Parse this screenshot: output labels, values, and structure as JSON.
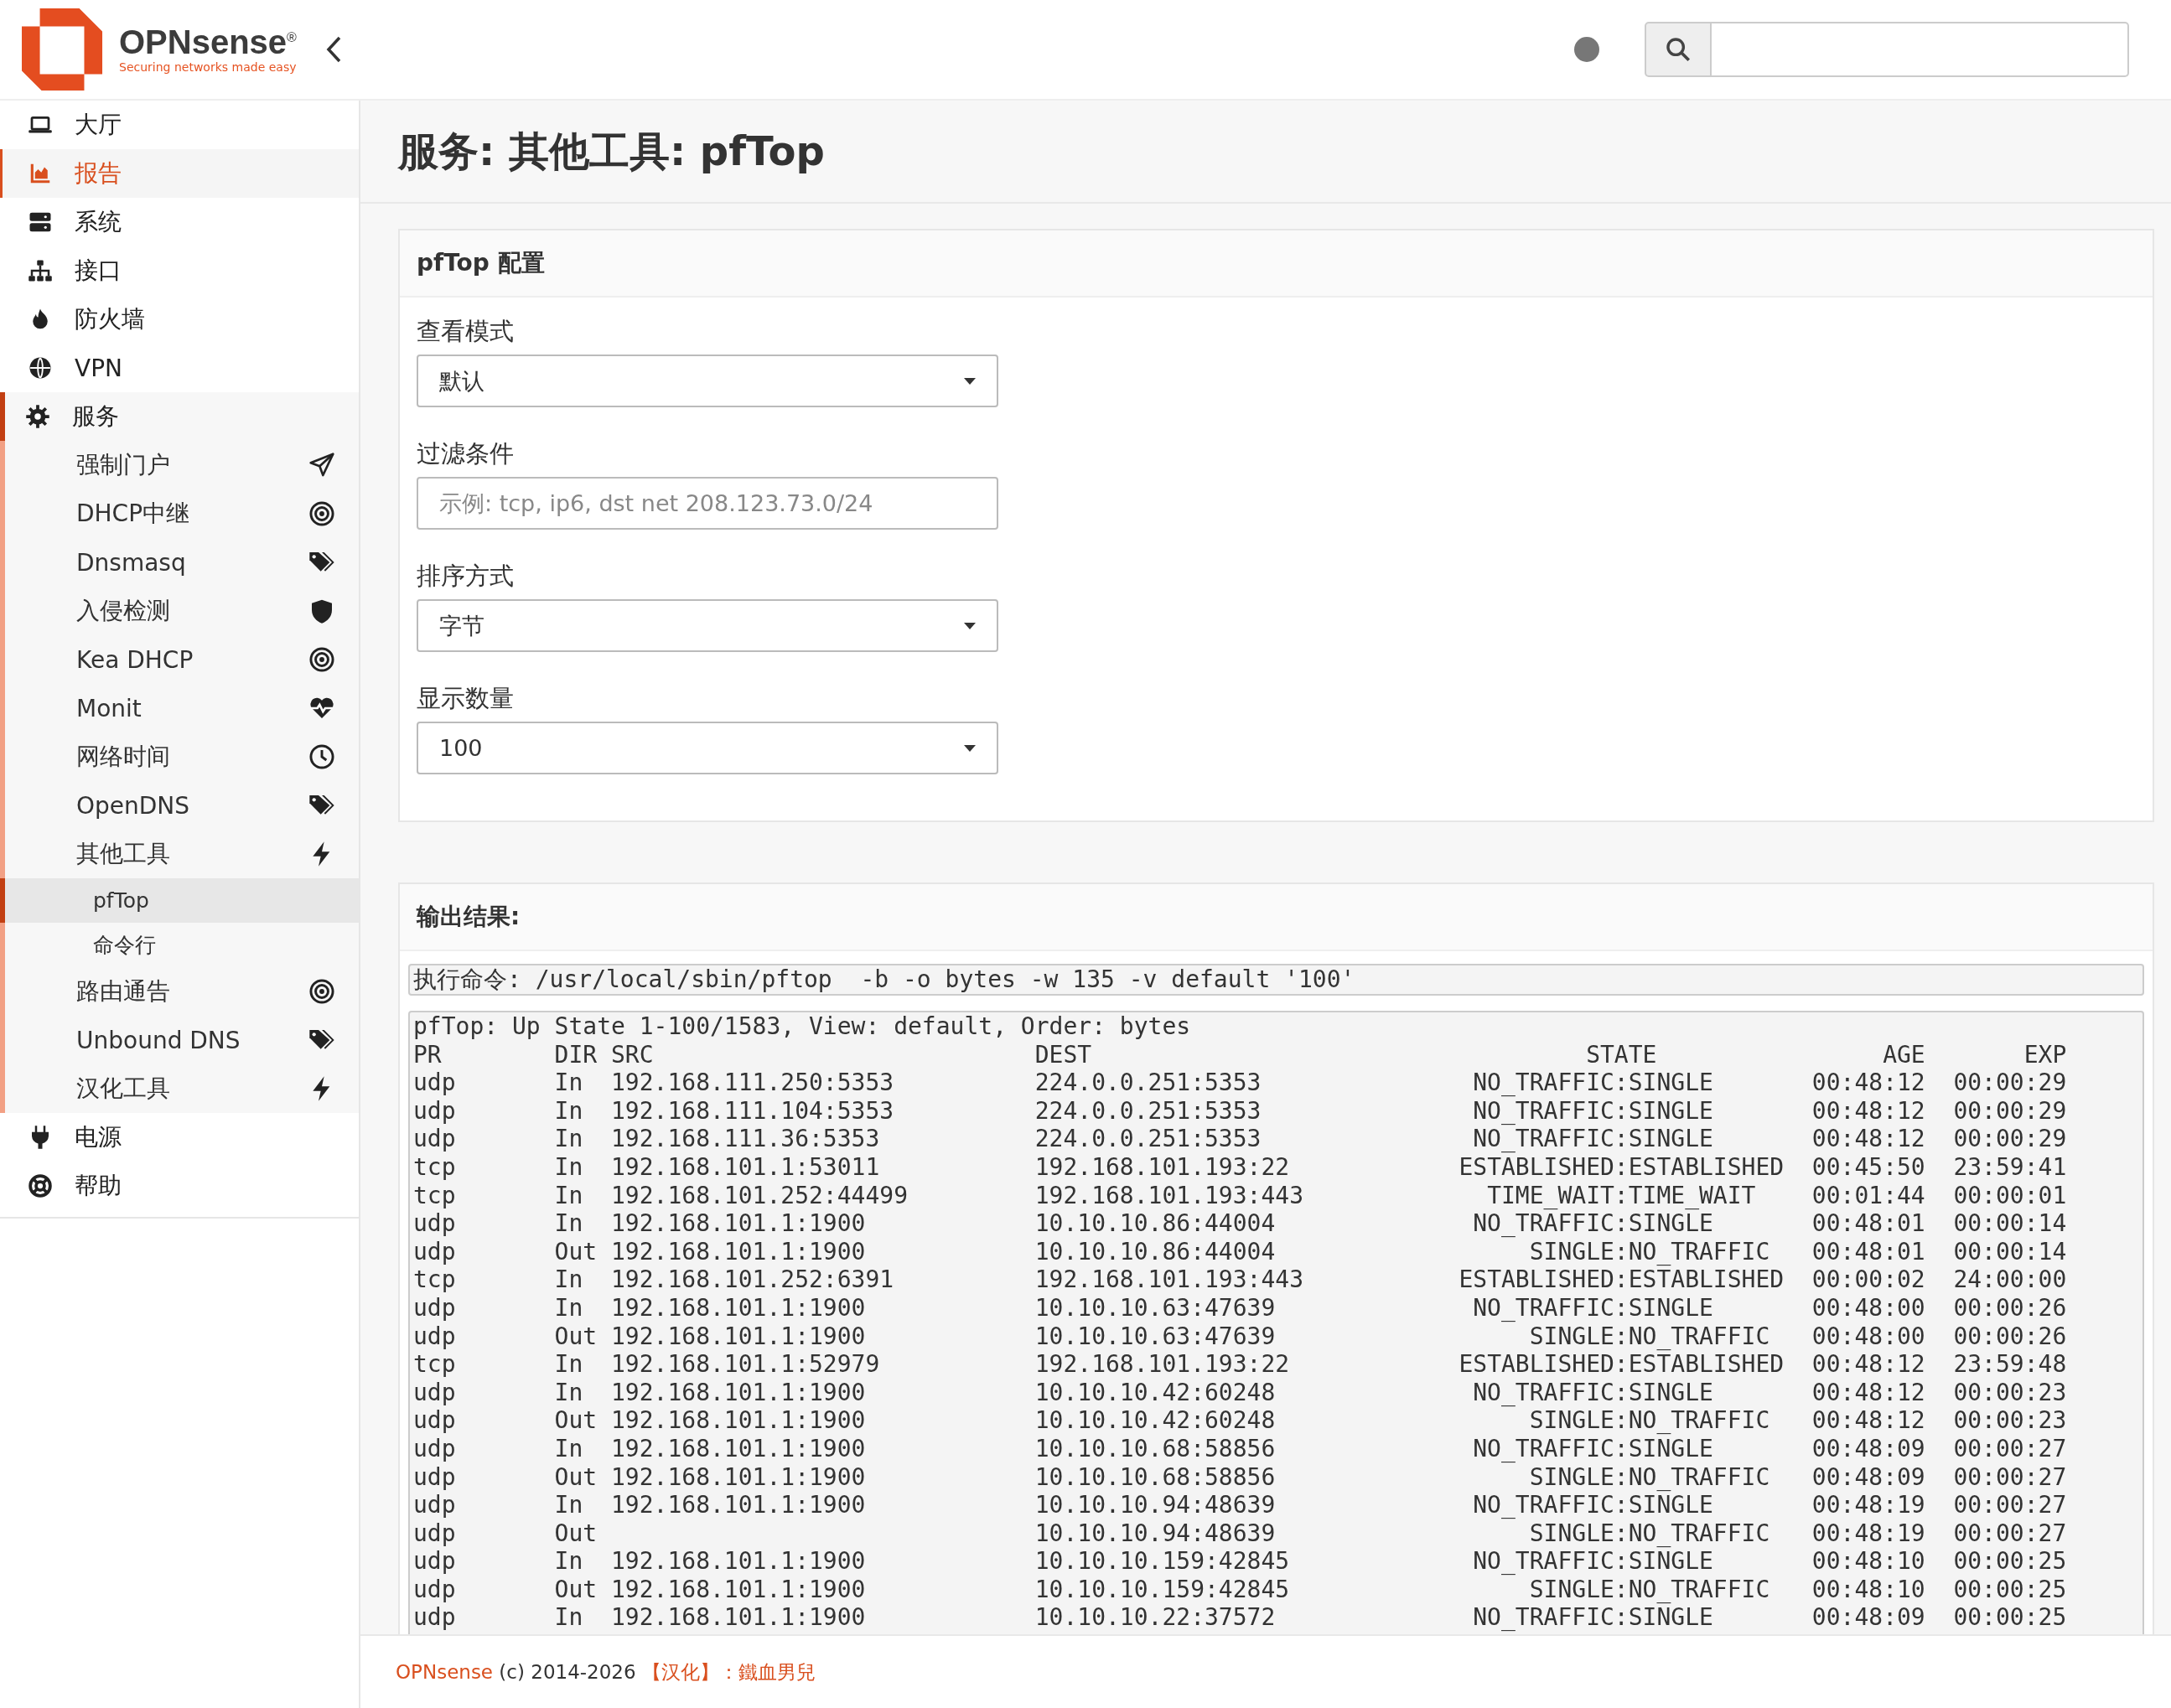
{
  "header": {
    "logo": {
      "name": "OPNsense",
      "mark": "®",
      "tagline": "Securing networks made easy"
    }
  },
  "sidebar": {
    "items": [
      {
        "label": "大厅",
        "highlighted": false
      },
      {
        "label": "报告",
        "highlighted": true
      },
      {
        "label": "系统",
        "highlighted": false
      },
      {
        "label": "接口",
        "highlighted": false
      },
      {
        "label": "防火墙",
        "highlighted": false
      },
      {
        "label": "VPN",
        "highlighted": false
      },
      {
        "label": "服务",
        "highlighted": false,
        "expanded": true,
        "children": [
          {
            "label": "强制门户"
          },
          {
            "label": "DHCP中继"
          },
          {
            "label": "Dnsmasq"
          },
          {
            "label": "入侵检测"
          },
          {
            "label": "Kea DHCP"
          },
          {
            "label": "Monit"
          },
          {
            "label": "网络时间"
          },
          {
            "label": "OpenDNS"
          },
          {
            "label": "其他工具",
            "expanded": true,
            "children": [
              {
                "label": "pfTop",
                "selected": true
              },
              {
                "label": "命令行",
                "selected": false
              }
            ]
          },
          {
            "label": "路由通告"
          },
          {
            "label": "Unbound DNS"
          },
          {
            "label": "汉化工具"
          }
        ]
      },
      {
        "label": "电源",
        "highlighted": false
      },
      {
        "label": "帮助",
        "highlighted": false
      }
    ]
  },
  "page_title": "服务: 其他工具: pfTop",
  "config": {
    "title": "pfTop 配置",
    "fields": [
      {
        "kind": "select",
        "label": "查看模式",
        "value": "默认"
      },
      {
        "kind": "text",
        "label": "过滤条件",
        "placeholder": "示例: tcp, ip6, dst net 208.123.73.0/24"
      },
      {
        "kind": "select",
        "label": "排序方式",
        "value": "字节"
      },
      {
        "kind": "select",
        "label": "显示数量",
        "value": "100"
      }
    ]
  },
  "output": {
    "title": "输出结果:",
    "command": "执行命令: /usr/local/sbin/pftop  -b -o bytes -w 135 -v default '100'",
    "summary": "pfTop: Up State 1-100/1583, View: default, Order: bytes",
    "columns": [
      "PR",
      "DIR",
      "SRC",
      "DEST",
      "STATE",
      "AGE",
      "EXP"
    ],
    "rows": [
      {
        "pr": "udp",
        "dir": "In",
        "src": "192.168.111.250:5353",
        "dest": "224.0.0.251:5353",
        "state": "NO_TRAFFIC:SINGLE",
        "age": "00:48:12",
        "exp": "00:00:29"
      },
      {
        "pr": "udp",
        "dir": "In",
        "src": "192.168.111.104:5353",
        "dest": "224.0.0.251:5353",
        "state": "NO_TRAFFIC:SINGLE",
        "age": "00:48:12",
        "exp": "00:00:29"
      },
      {
        "pr": "udp",
        "dir": "In",
        "src": "192.168.111.36:5353",
        "dest": "224.0.0.251:5353",
        "state": "NO_TRAFFIC:SINGLE",
        "age": "00:48:12",
        "exp": "00:00:29"
      },
      {
        "pr": "tcp",
        "dir": "In",
        "src": "192.168.101.1:53011",
        "dest": "192.168.101.193:22",
        "state": "ESTABLISHED:ESTABLISHED",
        "age": "00:45:50",
        "exp": "23:59:41"
      },
      {
        "pr": "tcp",
        "dir": "In",
        "src": "192.168.101.252:44499",
        "dest": "192.168.101.193:443",
        "state": "TIME_WAIT:TIME_WAIT",
        "age": "00:01:44",
        "exp": "00:00:01"
      },
      {
        "pr": "udp",
        "dir": "In",
        "src": "192.168.101.1:1900",
        "dest": "10.10.10.86:44004",
        "state": "NO_TRAFFIC:SINGLE",
        "age": "00:48:01",
        "exp": "00:00:14"
      },
      {
        "pr": "udp",
        "dir": "Out",
        "src": "192.168.101.1:1900",
        "dest": "10.10.10.86:44004",
        "state": "SINGLE:NO_TRAFFIC",
        "age": "00:48:01",
        "exp": "00:00:14"
      },
      {
        "pr": "tcp",
        "dir": "In",
        "src": "192.168.101.252:6391",
        "dest": "192.168.101.193:443",
        "state": "ESTABLISHED:ESTABLISHED",
        "age": "00:00:02",
        "exp": "24:00:00"
      },
      {
        "pr": "udp",
        "dir": "In",
        "src": "192.168.101.1:1900",
        "dest": "10.10.10.63:47639",
        "state": "NO_TRAFFIC:SINGLE",
        "age": "00:48:00",
        "exp": "00:00:26"
      },
      {
        "pr": "udp",
        "dir": "Out",
        "src": "192.168.101.1:1900",
        "dest": "10.10.10.63:47639",
        "state": "SINGLE:NO_TRAFFIC",
        "age": "00:48:00",
        "exp": "00:00:26"
      },
      {
        "pr": "tcp",
        "dir": "In",
        "src": "192.168.101.1:52979",
        "dest": "192.168.101.193:22",
        "state": "ESTABLISHED:ESTABLISHED",
        "age": "00:48:12",
        "exp": "23:59:48"
      },
      {
        "pr": "udp",
        "dir": "In",
        "src": "192.168.101.1:1900",
        "dest": "10.10.10.42:60248",
        "state": "NO_TRAFFIC:SINGLE",
        "age": "00:48:12",
        "exp": "00:00:23"
      },
      {
        "pr": "udp",
        "dir": "Out",
        "src": "192.168.101.1:1900",
        "dest": "10.10.10.42:60248",
        "state": "SINGLE:NO_TRAFFIC",
        "age": "00:48:12",
        "exp": "00:00:23"
      },
      {
        "pr": "udp",
        "dir": "In",
        "src": "192.168.101.1:1900",
        "dest": "10.10.10.68:58856",
        "state": "NO_TRAFFIC:SINGLE",
        "age": "00:48:09",
        "exp": "00:00:27"
      },
      {
        "pr": "udp",
        "dir": "Out",
        "src": "192.168.101.1:1900",
        "dest": "10.10.10.68:58856",
        "state": "SINGLE:NO_TRAFFIC",
        "age": "00:48:09",
        "exp": "00:00:27"
      },
      {
        "pr": "udp",
        "dir": "In",
        "src": "192.168.101.1:1900",
        "dest": "10.10.10.94:48639",
        "state": "NO_TRAFFIC:SINGLE",
        "age": "00:48:19",
        "exp": "00:00:27"
      },
      {
        "pr": "udp",
        "dir": "Out",
        "dest": "10.10.10.94:48639",
        "state": "SINGLE:NO_TRAFFIC",
        "age": "00:48:19",
        "exp": "00:00:27"
      },
      {
        "pr": "udp",
        "dir": "In",
        "src": "192.168.101.1:1900",
        "dest": "10.10.10.159:42845",
        "state": "NO_TRAFFIC:SINGLE",
        "age": "00:48:10",
        "exp": "00:00:25"
      },
      {
        "pr": "udp",
        "dir": "Out",
        "src": "192.168.101.1:1900",
        "dest": "10.10.10.159:42845",
        "state": "SINGLE:NO_TRAFFIC",
        "age": "00:48:10",
        "exp": "00:00:25"
      },
      {
        "pr": "udp",
        "dir": "In",
        "src": "192.168.101.1:1900",
        "dest": "10.10.10.22:37572",
        "state": "NO_TRAFFIC:SINGLE",
        "age": "00:48:09",
        "exp": "00:00:25"
      }
    ]
  },
  "footer": {
    "brand": "OPNsense",
    "copyright": "(c) 2014-2026",
    "credit": "【汉化】：鐵血男兒"
  }
}
